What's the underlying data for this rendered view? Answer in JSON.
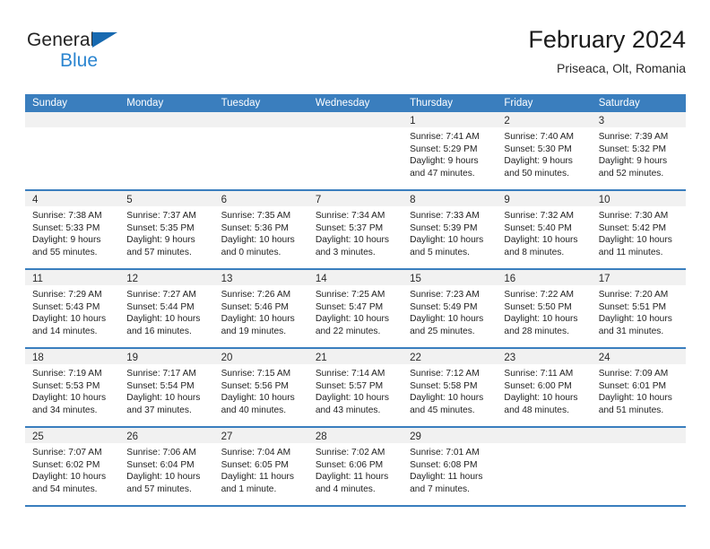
{
  "brand": {
    "name_dark": "General",
    "name_blue": "Blue",
    "triangle_icon": "brand-triangle-icon",
    "dark_color": "#232323",
    "blue_color": "#2b85d0",
    "triangle_color": "#1769b0"
  },
  "header": {
    "title": "February 2024",
    "location": "Priseaca, Olt, Romania"
  },
  "theme": {
    "header_blue": "#3a7ebe",
    "daynum_band": "#f1f1f1",
    "cell_bg": "#ffffff"
  },
  "weekday_headers": [
    "Sunday",
    "Monday",
    "Tuesday",
    "Wednesday",
    "Thursday",
    "Friday",
    "Saturday"
  ],
  "weeks": [
    [
      {
        "blank": true
      },
      {
        "blank": true
      },
      {
        "blank": true
      },
      {
        "blank": true
      },
      {
        "day": "1",
        "sunrise": "Sunrise: 7:41 AM",
        "sunset": "Sunset: 5:29 PM",
        "daylight_line1": "Daylight: 9 hours",
        "daylight_line2": "and 47 minutes."
      },
      {
        "day": "2",
        "sunrise": "Sunrise: 7:40 AM",
        "sunset": "Sunset: 5:30 PM",
        "daylight_line1": "Daylight: 9 hours",
        "daylight_line2": "and 50 minutes."
      },
      {
        "day": "3",
        "sunrise": "Sunrise: 7:39 AM",
        "sunset": "Sunset: 5:32 PM",
        "daylight_line1": "Daylight: 9 hours",
        "daylight_line2": "and 52 minutes."
      }
    ],
    [
      {
        "day": "4",
        "sunrise": "Sunrise: 7:38 AM",
        "sunset": "Sunset: 5:33 PM",
        "daylight_line1": "Daylight: 9 hours",
        "daylight_line2": "and 55 minutes."
      },
      {
        "day": "5",
        "sunrise": "Sunrise: 7:37 AM",
        "sunset": "Sunset: 5:35 PM",
        "daylight_line1": "Daylight: 9 hours",
        "daylight_line2": "and 57 minutes."
      },
      {
        "day": "6",
        "sunrise": "Sunrise: 7:35 AM",
        "sunset": "Sunset: 5:36 PM",
        "daylight_line1": "Daylight: 10 hours",
        "daylight_line2": "and 0 minutes."
      },
      {
        "day": "7",
        "sunrise": "Sunrise: 7:34 AM",
        "sunset": "Sunset: 5:37 PM",
        "daylight_line1": "Daylight: 10 hours",
        "daylight_line2": "and 3 minutes."
      },
      {
        "day": "8",
        "sunrise": "Sunrise: 7:33 AM",
        "sunset": "Sunset: 5:39 PM",
        "daylight_line1": "Daylight: 10 hours",
        "daylight_line2": "and 5 minutes."
      },
      {
        "day": "9",
        "sunrise": "Sunrise: 7:32 AM",
        "sunset": "Sunset: 5:40 PM",
        "daylight_line1": "Daylight: 10 hours",
        "daylight_line2": "and 8 minutes."
      },
      {
        "day": "10",
        "sunrise": "Sunrise: 7:30 AM",
        "sunset": "Sunset: 5:42 PM",
        "daylight_line1": "Daylight: 10 hours",
        "daylight_line2": "and 11 minutes."
      }
    ],
    [
      {
        "day": "11",
        "sunrise": "Sunrise: 7:29 AM",
        "sunset": "Sunset: 5:43 PM",
        "daylight_line1": "Daylight: 10 hours",
        "daylight_line2": "and 14 minutes."
      },
      {
        "day": "12",
        "sunrise": "Sunrise: 7:27 AM",
        "sunset": "Sunset: 5:44 PM",
        "daylight_line1": "Daylight: 10 hours",
        "daylight_line2": "and 16 minutes."
      },
      {
        "day": "13",
        "sunrise": "Sunrise: 7:26 AM",
        "sunset": "Sunset: 5:46 PM",
        "daylight_line1": "Daylight: 10 hours",
        "daylight_line2": "and 19 minutes."
      },
      {
        "day": "14",
        "sunrise": "Sunrise: 7:25 AM",
        "sunset": "Sunset: 5:47 PM",
        "daylight_line1": "Daylight: 10 hours",
        "daylight_line2": "and 22 minutes."
      },
      {
        "day": "15",
        "sunrise": "Sunrise: 7:23 AM",
        "sunset": "Sunset: 5:49 PM",
        "daylight_line1": "Daylight: 10 hours",
        "daylight_line2": "and 25 minutes."
      },
      {
        "day": "16",
        "sunrise": "Sunrise: 7:22 AM",
        "sunset": "Sunset: 5:50 PM",
        "daylight_line1": "Daylight: 10 hours",
        "daylight_line2": "and 28 minutes."
      },
      {
        "day": "17",
        "sunrise": "Sunrise: 7:20 AM",
        "sunset": "Sunset: 5:51 PM",
        "daylight_line1": "Daylight: 10 hours",
        "daylight_line2": "and 31 minutes."
      }
    ],
    [
      {
        "day": "18",
        "sunrise": "Sunrise: 7:19 AM",
        "sunset": "Sunset: 5:53 PM",
        "daylight_line1": "Daylight: 10 hours",
        "daylight_line2": "and 34 minutes."
      },
      {
        "day": "19",
        "sunrise": "Sunrise: 7:17 AM",
        "sunset": "Sunset: 5:54 PM",
        "daylight_line1": "Daylight: 10 hours",
        "daylight_line2": "and 37 minutes."
      },
      {
        "day": "20",
        "sunrise": "Sunrise: 7:15 AM",
        "sunset": "Sunset: 5:56 PM",
        "daylight_line1": "Daylight: 10 hours",
        "daylight_line2": "and 40 minutes."
      },
      {
        "day": "21",
        "sunrise": "Sunrise: 7:14 AM",
        "sunset": "Sunset: 5:57 PM",
        "daylight_line1": "Daylight: 10 hours",
        "daylight_line2": "and 43 minutes."
      },
      {
        "day": "22",
        "sunrise": "Sunrise: 7:12 AM",
        "sunset": "Sunset: 5:58 PM",
        "daylight_line1": "Daylight: 10 hours",
        "daylight_line2": "and 45 minutes."
      },
      {
        "day": "23",
        "sunrise": "Sunrise: 7:11 AM",
        "sunset": "Sunset: 6:00 PM",
        "daylight_line1": "Daylight: 10 hours",
        "daylight_line2": "and 48 minutes."
      },
      {
        "day": "24",
        "sunrise": "Sunrise: 7:09 AM",
        "sunset": "Sunset: 6:01 PM",
        "daylight_line1": "Daylight: 10 hours",
        "daylight_line2": "and 51 minutes."
      }
    ],
    [
      {
        "day": "25",
        "sunrise": "Sunrise: 7:07 AM",
        "sunset": "Sunset: 6:02 PM",
        "daylight_line1": "Daylight: 10 hours",
        "daylight_line2": "and 54 minutes."
      },
      {
        "day": "26",
        "sunrise": "Sunrise: 7:06 AM",
        "sunset": "Sunset: 6:04 PM",
        "daylight_line1": "Daylight: 10 hours",
        "daylight_line2": "and 57 minutes."
      },
      {
        "day": "27",
        "sunrise": "Sunrise: 7:04 AM",
        "sunset": "Sunset: 6:05 PM",
        "daylight_line1": "Daylight: 11 hours",
        "daylight_line2": "and 1 minute."
      },
      {
        "day": "28",
        "sunrise": "Sunrise: 7:02 AM",
        "sunset": "Sunset: 6:06 PM",
        "daylight_line1": "Daylight: 11 hours",
        "daylight_line2": "and 4 minutes."
      },
      {
        "day": "29",
        "sunrise": "Sunrise: 7:01 AM",
        "sunset": "Sunset: 6:08 PM",
        "daylight_line1": "Daylight: 11 hours",
        "daylight_line2": "and 7 minutes."
      },
      {
        "blank": true
      },
      {
        "blank": true
      }
    ]
  ]
}
